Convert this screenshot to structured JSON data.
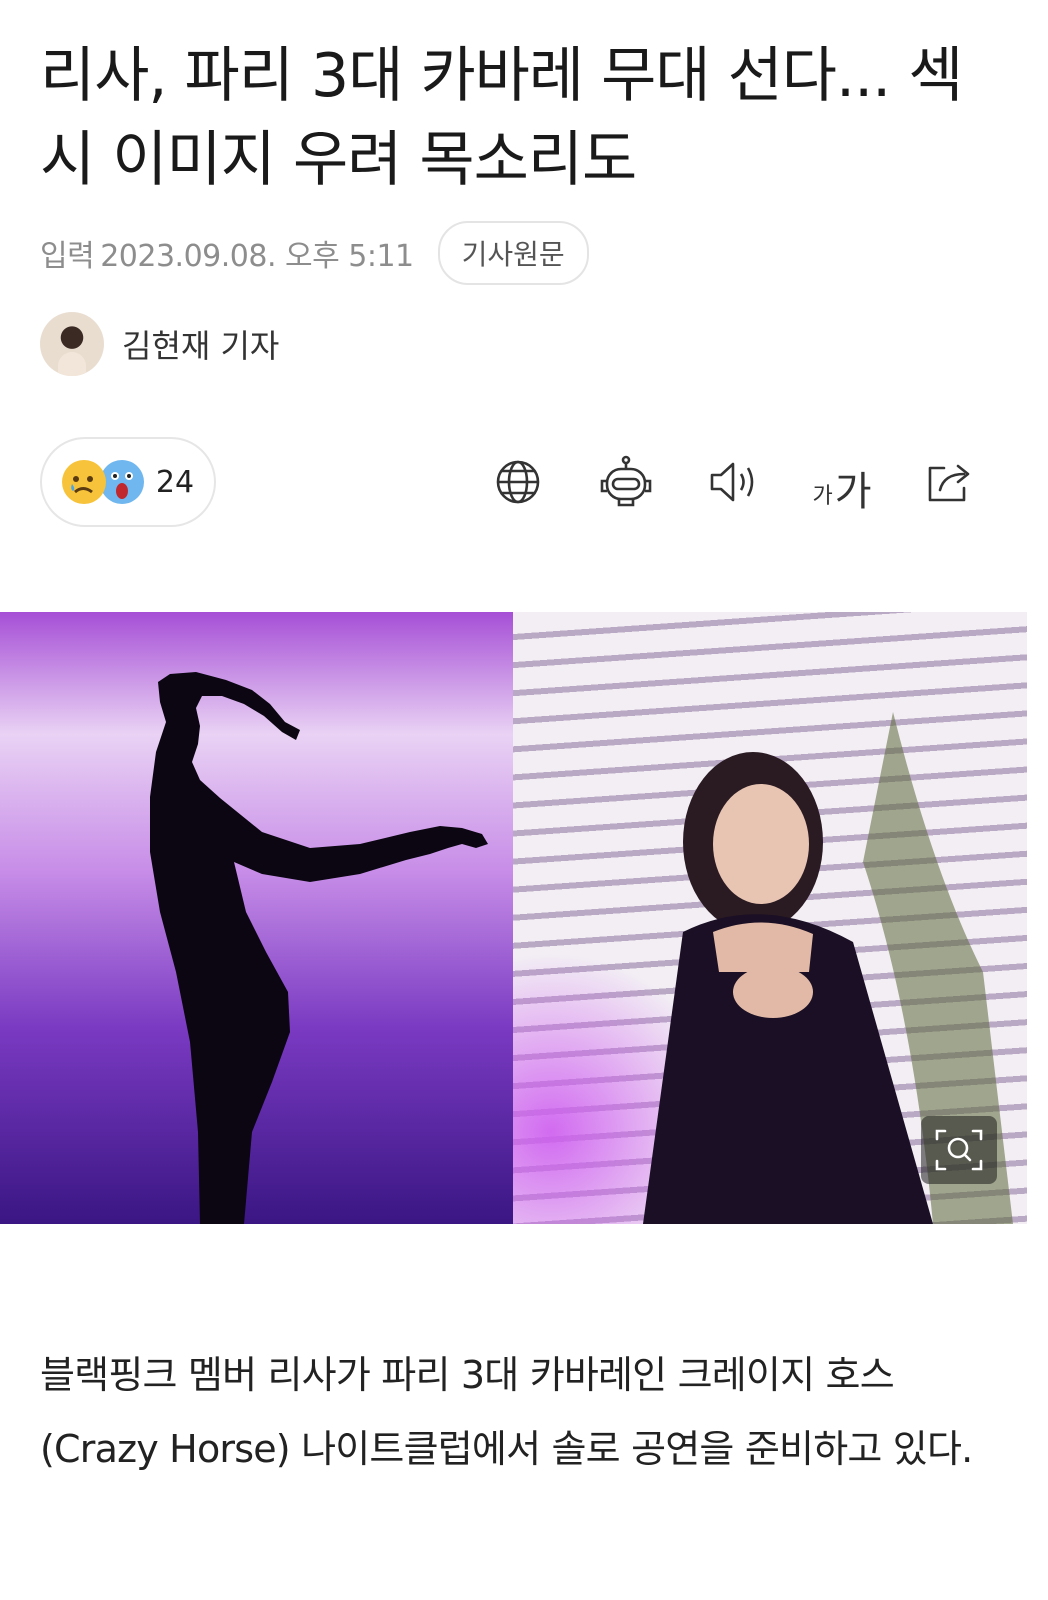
{
  "article": {
    "headline": "리사, 파리 3대 카바레 무대 선다... 섹시 이미지 우려 목소리도",
    "date_label": "입력",
    "date_value": "2023.09.08. 오후 5:11",
    "original_button": "기사원문",
    "reporter": "김현재 기자",
    "body": "블랙핑크 멤버 리사가 파리 3대 카바레인 크레이지 호스(Crazy Horse) 나이트클럽에서 솔로 공연을 준비하고 있다."
  },
  "reactions": {
    "count": "24",
    "emojis": [
      "sad-face-icon",
      "shocked-face-icon"
    ]
  },
  "toolbar": {
    "icons": [
      "globe-icon",
      "robot-icon",
      "speaker-icon",
      "font-size-icon",
      "share-icon"
    ],
    "font_size_small": "가",
    "font_size_large": "가"
  },
  "colors": {
    "accent_purple": "#8a3fd0",
    "meta_gray": "#8d8d8d"
  }
}
